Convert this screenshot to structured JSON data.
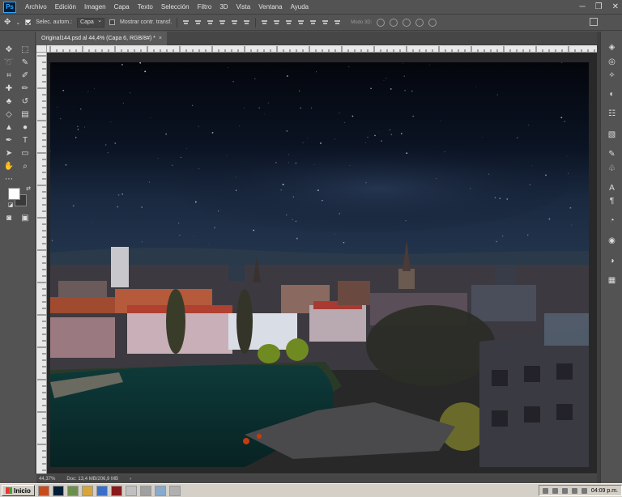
{
  "app": {
    "logo": "Ps",
    "menu": [
      "Archivo",
      "Edición",
      "Imagen",
      "Capa",
      "Texto",
      "Selección",
      "Filtro",
      "3D",
      "Vista",
      "Ventana",
      "Ayuda"
    ],
    "window_controls": [
      "minimize-icon",
      "restore-icon",
      "close-icon"
    ]
  },
  "options": {
    "auto_select_label": "Selec. autom.:",
    "auto_select_checked": true,
    "auto_select_target": "Capa",
    "show_transform_label": "Mostrar contr. transf.",
    "show_transform_checked": false,
    "mode_3d_label": "Modo 3D:"
  },
  "document": {
    "tab_title": "Original144.psd al 44,4% (Capa 6, RGB/8#) *",
    "zoom": "44,37%",
    "doc_size": "Doc: 13,4 MB/206,9 MB"
  },
  "tools": [
    "move-icon",
    "marquee-icon",
    "lasso-icon",
    "quick-select-icon",
    "crop-icon",
    "eyedropper-icon",
    "healing-brush-icon",
    "brush-icon",
    "clone-stamp-icon",
    "history-brush-icon",
    "eraser-icon",
    "gradient-icon",
    "blur-icon",
    "dodge-icon",
    "pen-icon",
    "type-icon",
    "path-select-icon",
    "rectangle-icon",
    "hand-icon",
    "zoom-icon",
    "more-tools-icon"
  ],
  "colors": {
    "foreground": "#ffffff",
    "background": "#3a3a3a",
    "ui_bg": "#535353",
    "sky_top": "#05080f",
    "sky_horizon": "#1b2a3e"
  },
  "right_panel": [
    "layers-icon",
    "channels-icon",
    "paths-icon",
    "adjustments-icon",
    "properties-icon",
    "libraries-icon",
    "brush-settings-icon",
    "clone-source-icon",
    "character-icon",
    "paragraph-icon",
    "3d-icon",
    "color-icon",
    "swatches-icon",
    "histogram-icon"
  ],
  "taskbar": {
    "start_label": "Inicio",
    "clock": "04:09 p.m."
  }
}
